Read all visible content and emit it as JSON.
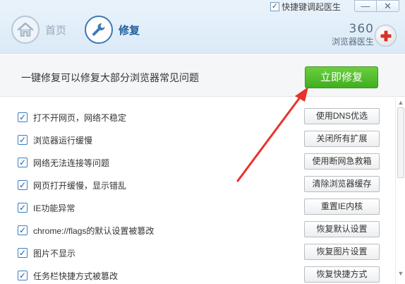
{
  "header": {
    "hotkey_label": "快捷键调起医生",
    "hotkey_checked": "✓",
    "minimize_glyph": "—",
    "close_glyph": "✕",
    "nav": [
      {
        "label": "首页",
        "icon": "home-icon",
        "active": false
      },
      {
        "label": "修复",
        "icon": "wrench-icon",
        "active": true
      }
    ],
    "brand_number": "360",
    "brand_name": "浏览器医生",
    "brand_logo_icon": "medical-cross-icon"
  },
  "subheader": {
    "headline": "一键修复可以修复大部分浏览器常见问题",
    "primary_button": "立即修复"
  },
  "items": [
    {
      "label": "打不开网页，网络不稳定",
      "action": "使用DNS优选",
      "checked": true
    },
    {
      "label": "浏览器运行缓慢",
      "action": "关闭所有扩展",
      "checked": true
    },
    {
      "label": "网络无法连接等问题",
      "action": "使用断网急救箱",
      "checked": true
    },
    {
      "label": "网页打开缓慢，显示错乱",
      "action": "清除浏览器缓存",
      "checked": true
    },
    {
      "label": "IE功能异常",
      "action": "重置IE内核",
      "checked": true
    },
    {
      "label": "chrome://flags的默认设置被篡改",
      "action": "恢复默认设置",
      "checked": true
    },
    {
      "label": "图片不显示",
      "action": "恢复图片设置",
      "checked": true
    },
    {
      "label": "任务栏快捷方式被篡改",
      "action": "恢复快捷方式",
      "checked": true
    }
  ],
  "checkmark": "✓",
  "scrollbar": {
    "up_glyph": "▲",
    "down_glyph": "▼"
  },
  "colors": {
    "accent_blue": "#1f5f9f",
    "primary_green": "#3fae20",
    "annotation_red": "#e8332a"
  }
}
